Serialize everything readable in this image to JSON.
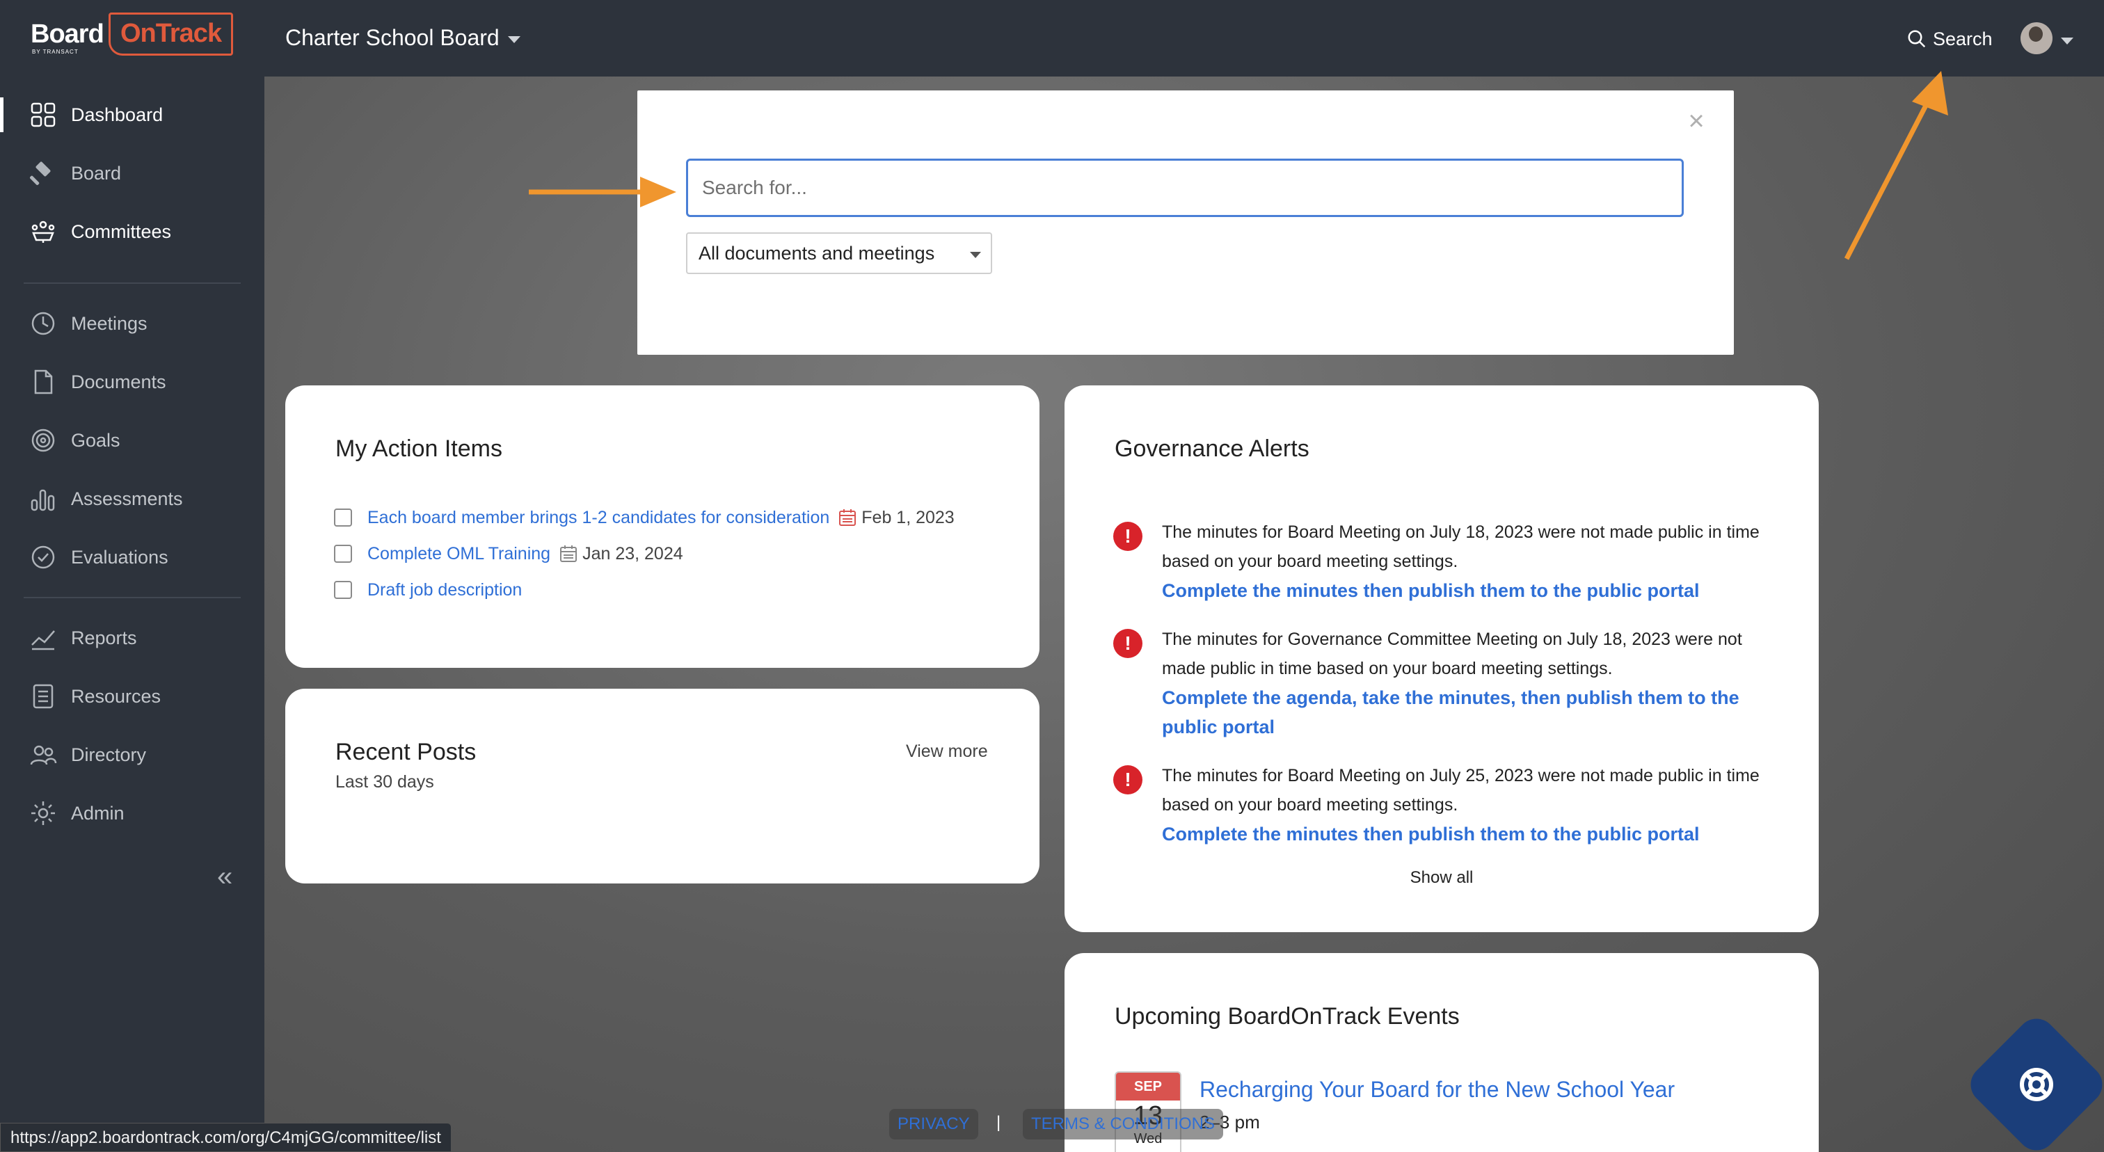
{
  "topbar": {
    "logo_board": "Board",
    "logo_ontrack": "OnTrack",
    "logo_sub": "BY TRANSACT",
    "org_name": "Charter School Board",
    "search_label": "Search"
  },
  "sidebar": {
    "items": [
      {
        "label": "Dashboard",
        "icon": "dashboard-icon"
      },
      {
        "label": "Board",
        "icon": "gavel-icon"
      },
      {
        "label": "Committees",
        "icon": "committees-icon"
      },
      {
        "label": "Meetings",
        "icon": "clock-icon"
      },
      {
        "label": "Documents",
        "icon": "document-icon"
      },
      {
        "label": "Goals",
        "icon": "target-icon"
      },
      {
        "label": "Assessments",
        "icon": "bar-chart-icon"
      },
      {
        "label": "Evaluations",
        "icon": "check-circle-icon"
      },
      {
        "label": "Reports",
        "icon": "line-chart-icon"
      },
      {
        "label": "Resources",
        "icon": "list-doc-icon"
      },
      {
        "label": "Directory",
        "icon": "people-icon"
      },
      {
        "label": "Admin",
        "icon": "gear-icon"
      }
    ],
    "collapse": "«"
  },
  "search_modal": {
    "placeholder": "Search for...",
    "scope_selected": "All documents and meetings",
    "close": "×"
  },
  "action_items": {
    "title": "My Action Items",
    "items": [
      {
        "text": "Each board member brings 1-2 candidates for consideration",
        "date": "Feb 1, 2023",
        "overdue": true
      },
      {
        "text": "Complete OML Training",
        "date": "Jan 23, 2024",
        "overdue": false
      },
      {
        "text": "Draft job description",
        "date": "",
        "overdue": false
      }
    ]
  },
  "recent_posts": {
    "title": "Recent Posts",
    "subtitle": "Last 30 days",
    "view_more": "View more"
  },
  "governance_alerts": {
    "title": "Governance Alerts",
    "alerts": [
      {
        "text": "The minutes for Board Meeting on July 18, 2023 were not made public in time based on your board meeting settings.",
        "link": "Complete the minutes then publish them to the public portal"
      },
      {
        "text": "The minutes for Governance Committee Meeting on July 18, 2023 were not made public in time based on your board meeting settings.",
        "link": "Complete the agenda, take the minutes, then publish them to the public portal"
      },
      {
        "text": "The minutes for Board Meeting on July 25, 2023 were not made public in time based on your board meeting settings.",
        "link": "Complete the minutes then publish them to the public portal"
      }
    ],
    "show_all": "Show all"
  },
  "events": {
    "title": "Upcoming BoardOnTrack Events",
    "items": [
      {
        "month": "SEP",
        "day": "13",
        "dow": "Wed",
        "title": "Recharging Your Board for the New School Year",
        "time": "2–3 pm"
      }
    ]
  },
  "footer": {
    "privacy": "PRIVACY",
    "separator": "|",
    "terms": "TERMS & CONDITIONS"
  },
  "status_url": "https://app2.boardontrack.com/org/C4mjGG/committee/list",
  "colors": {
    "nav_bg": "#2d333c",
    "link": "#2f6fd6",
    "alert_red": "#d8232a",
    "brand_orange": "#e05a3c",
    "annotation_arrow": "#f0962e"
  }
}
